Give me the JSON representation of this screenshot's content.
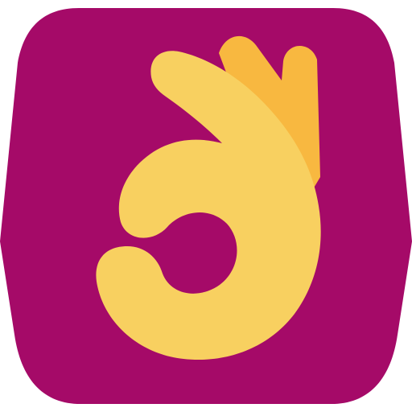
{
  "icon": {
    "name": "ok-hand-icon",
    "colors": {
      "background": "#A50A68",
      "hand": "#F8D060",
      "hand_shadow": "#F8B840"
    }
  }
}
